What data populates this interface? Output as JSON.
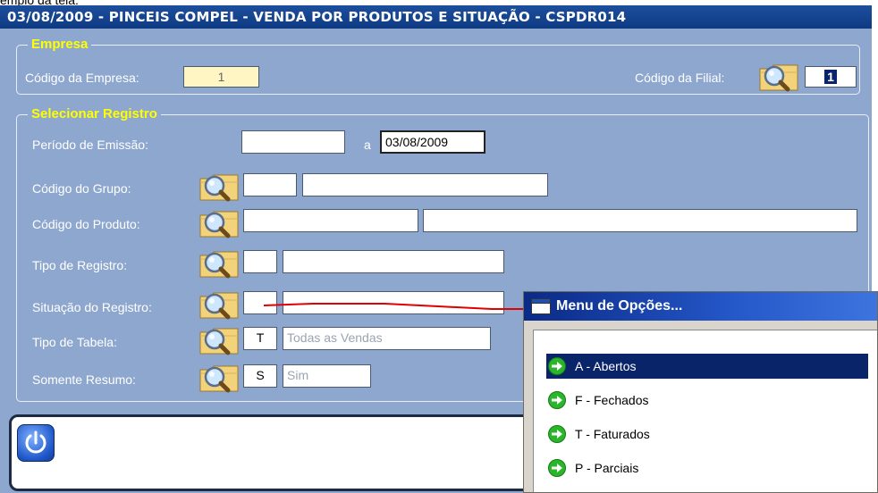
{
  "window": {
    "top_cropped_text": "emplo da tela:",
    "title": "03/08/2009  -  PINCEIS COMPEL  -  VENDA POR PRODUTOS E SITUAÇÃO  -  CSPDR014"
  },
  "empresa": {
    "legend": "Empresa",
    "codigo_empresa_label": "Código da Empresa:",
    "codigo_empresa_value": "1",
    "codigo_filial_label": "Código da Filial:",
    "codigo_filial_value": "1"
  },
  "selecionar": {
    "legend": "Selecionar Registro",
    "periodo_label": "Período de Emissão:",
    "periodo_de": "",
    "periodo_a_label": "a",
    "periodo_ate": "03/08/2009",
    "grupo_label": "Código do Grupo:",
    "grupo_code": "",
    "grupo_desc": "",
    "produto_label": "Código do Produto:",
    "produto_code": "",
    "produto_desc": "",
    "tipo_registro_label": "Tipo de Registro:",
    "tipo_registro_code": "",
    "tipo_registro_desc": "",
    "situacao_label": "Situação do Registro:",
    "situacao_code": "",
    "situacao_desc": "",
    "tipo_tabela_label": "Tipo de Tabela:",
    "tipo_tabela_code": "T",
    "tipo_tabela_desc": "Todas as Vendas",
    "resumo_label": "Somente Resumo:",
    "resumo_code": "S",
    "resumo_desc": "Sim"
  },
  "menu": {
    "title": "Menu de Opções...",
    "items": [
      {
        "label": "A - Abertos",
        "selected": true
      },
      {
        "label": "F - Fechados",
        "selected": false
      },
      {
        "label": "T - Faturados",
        "selected": false
      },
      {
        "label": "P - Parciais",
        "selected": false
      }
    ]
  },
  "icons": {
    "lookup": "folder-magnifier-icon",
    "power": "power-icon",
    "menu_item": "green-arrow-icon",
    "menu_window": "window-icon"
  },
  "colors": {
    "title_bar": "#0e3a82",
    "panel_bg": "#8ea7cf",
    "legend_text": "#ffff00",
    "annotation_line": "#e00000",
    "selection": "#0a246a"
  }
}
